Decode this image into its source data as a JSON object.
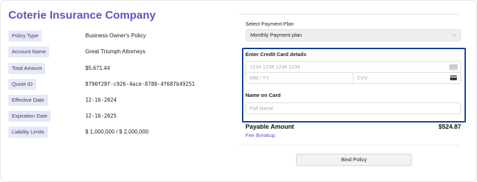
{
  "company_name": "Coterie Insurance Company",
  "details": [
    {
      "label": "Policy Type",
      "value": "Business Owner's Policy"
    },
    {
      "label": "Account Name",
      "value": "Great Triumph Attorneys"
    },
    {
      "label": "Total Amount",
      "value": "$5,671.44"
    },
    {
      "label": "Quote ID",
      "value": "8790f28f-c926-4ace-8780-4f687b49251"
    },
    {
      "label": "Effective Date",
      "value": "12-16-2024"
    },
    {
      "label": "Expiration Date",
      "value": "12-16-2025"
    },
    {
      "label": "Liability Limits",
      "value": "$ 1,000,000 / $ 2,000,000"
    }
  ],
  "payment": {
    "plan_label": "Select Payment Plan",
    "plan_value": "Monthly Payment plan",
    "card_section_label": "Enter Credit Card details",
    "card_number_placeholder": "1234 1234 1234 1234",
    "expiry_placeholder": "MM / YY",
    "cvv_placeholder": "CVV",
    "name_label": "Name on Card",
    "name_placeholder": "Full Name",
    "payable_label": "Payable Amount",
    "payable_value": "$524.87",
    "fee_link": "Fee Breakup",
    "bind_button": "Bind Policy"
  },
  "colors": {
    "brand": "#6a4fc3",
    "highlight_border": "#0b3d9a",
    "label_chip_bg": "#e6e8f7"
  },
  "icons": {
    "card_generic": "card-icon",
    "cvv": "cvv-card-icon",
    "select_chevron": "chevron-down-icon"
  }
}
